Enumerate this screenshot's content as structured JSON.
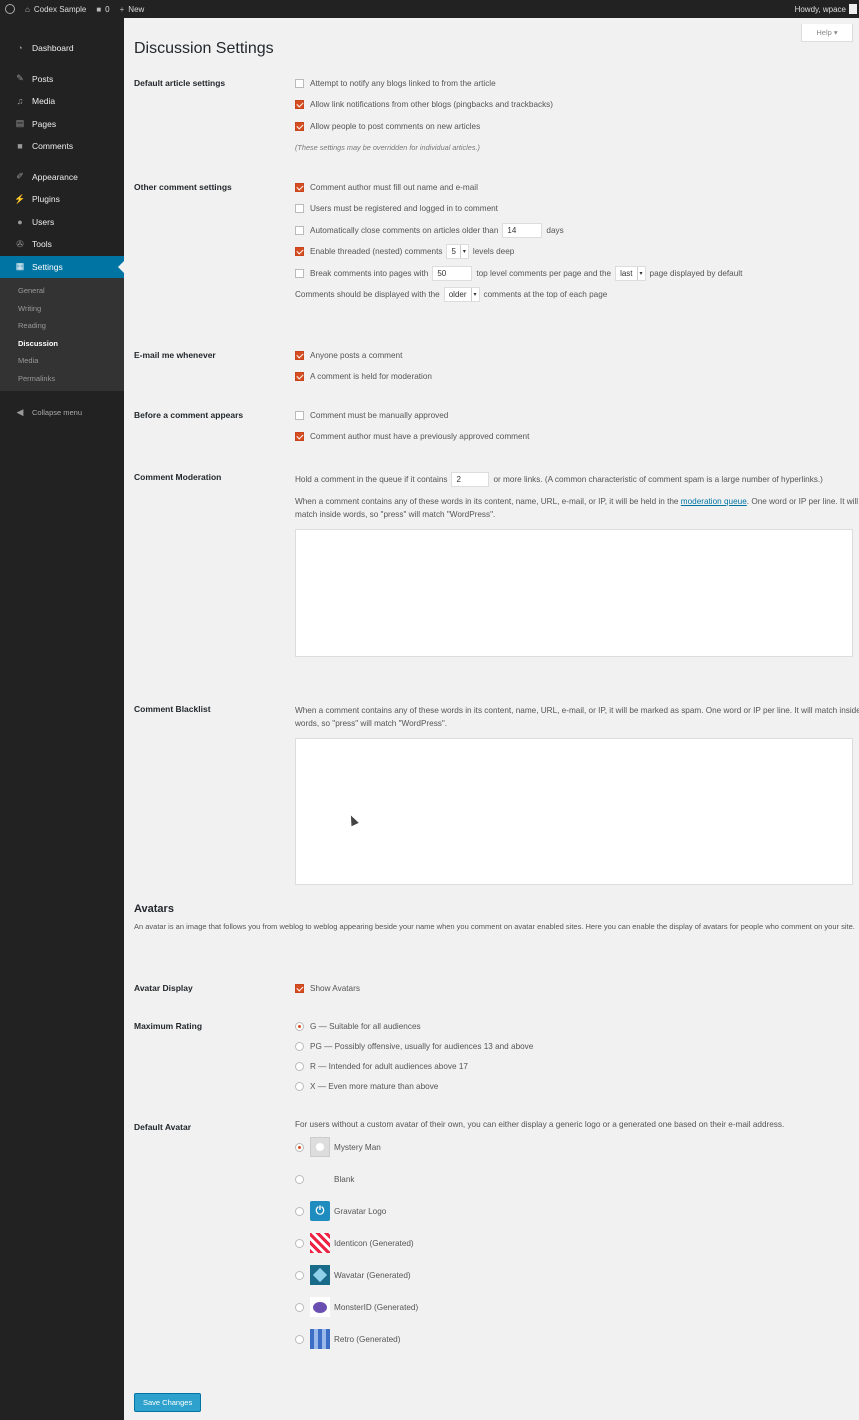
{
  "adminbar": {
    "site_name": "Codex Sample",
    "comments_count": "0",
    "new_label": "New",
    "howdy": "Howdy, wpace"
  },
  "help_label": "Help ▾",
  "sidebar": {
    "items": [
      {
        "label": "Dashboard",
        "icon": "dashboard-icon"
      },
      {
        "label": "Posts",
        "icon": "pin-icon"
      },
      {
        "label": "Media",
        "icon": "media-icon"
      },
      {
        "label": "Pages",
        "icon": "pages-icon"
      },
      {
        "label": "Comments",
        "icon": "comments-icon"
      },
      {
        "label": "Appearance",
        "icon": "brush-icon"
      },
      {
        "label": "Plugins",
        "icon": "plugin-icon"
      },
      {
        "label": "Users",
        "icon": "user-icon"
      },
      {
        "label": "Tools",
        "icon": "wrench-icon"
      },
      {
        "label": "Settings",
        "icon": "settings-icon"
      }
    ],
    "submenu": [
      "General",
      "Writing",
      "Reading",
      "Discussion",
      "Media",
      "Permalinks"
    ],
    "collapse": "Collapse menu"
  },
  "page_title": "Discussion Settings",
  "default_article": {
    "label": "Default article settings",
    "options": [
      "Attempt to notify any blogs linked to from the article",
      "Allow link notifications from other blogs (pingbacks and trackbacks)",
      "Allow people to post comments on new articles"
    ],
    "note": "(These settings may be overridden for individual articles.)"
  },
  "other_comment": {
    "label": "Other comment settings",
    "author_fill": "Comment author must fill out name and e-mail",
    "registered": "Users must be registered and logged in to comment",
    "auto_close_pre": "Automatically close comments on articles older than",
    "auto_close_days": "14",
    "auto_close_post": "days",
    "threaded_pre": "Enable threaded (nested) comments",
    "threaded_depth": "5",
    "threaded_post": "levels deep",
    "break_pre": "Break comments into pages with",
    "break_count": "50",
    "break_mid": "top level comments per page and the",
    "break_page": "last",
    "break_post": "page displayed by default",
    "order_pre": "Comments should be displayed with the",
    "order_value": "older",
    "order_post": "comments at the top of each page"
  },
  "email_me": {
    "label": "E-mail me whenever",
    "options": [
      "Anyone posts a comment",
      "A comment is held for moderation"
    ]
  },
  "before_appears": {
    "label": "Before a comment appears",
    "options": [
      "Comment must be manually approved",
      "Comment author must have a previously approved comment"
    ]
  },
  "moderation": {
    "label": "Comment Moderation",
    "hold_pre": "Hold a comment in the queue if it contains",
    "hold_links": "2",
    "hold_post": "or more links. (A common characteristic of comment spam is a large number of hyperlinks.)",
    "words_pre": "When a comment contains any of these words in its content, name, URL, e-mail, or IP, it will be held in the",
    "words_link": "moderation queue",
    "words_post": ". One word or IP per line. It will match inside words, so \"press\" will match \"WordPress\"."
  },
  "blacklist": {
    "label": "Comment Blacklist",
    "text": "When a comment contains any of these words in its content, name, URL, e-mail, or IP, it will be marked as spam. One word or IP per line. It will match inside words, so \"press\" will match \"WordPress\"."
  },
  "avatars": {
    "heading": "Avatars",
    "description": "An avatar is an image that follows you from weblog to weblog appearing beside your name when you comment on avatar enabled sites. Here you can enable the display of avatars for people who comment on your site.",
    "display_label": "Avatar Display",
    "display_option": "Show Avatars",
    "rating_label": "Maximum Rating",
    "ratings": [
      "G — Suitable for all audiences",
      "PG — Possibly offensive, usually for audiences 13 and above",
      "R — Intended for adult audiences above 17",
      "X — Even more mature than above"
    ],
    "default_label": "Default Avatar",
    "default_desc": "For users without a custom avatar of their own, you can either display a generic logo or a generated one based on their e-mail address.",
    "defaults": [
      "Mystery Man",
      "Blank",
      "Gravatar Logo",
      "Identicon (Generated)",
      "Wavatar (Generated)",
      "MonsterID (Generated)",
      "Retro (Generated)"
    ]
  },
  "save_label": "Save Changes",
  "colors": {
    "accent": "#0074a2",
    "checkbox": "#d54e21",
    "button": "#2ea2cc"
  }
}
